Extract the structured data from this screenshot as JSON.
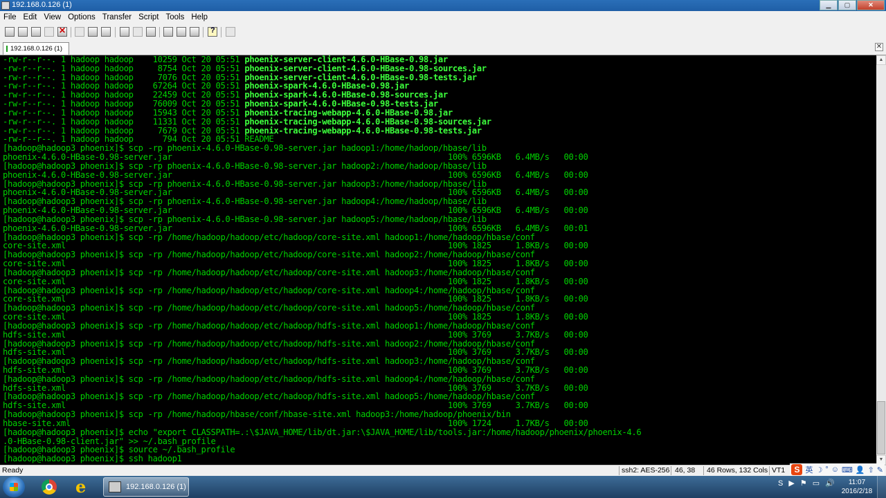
{
  "window": {
    "title": "192.168.0.126 (1)",
    "buttons": {
      "minimize": "▁",
      "maximize": "▢",
      "close": "✕"
    }
  },
  "menu": [
    "File",
    "Edit",
    "View",
    "Options",
    "Transfer",
    "Script",
    "Tools",
    "Help"
  ],
  "toolbar_icons": [
    "connect-icon",
    "quick-connect-icon",
    "connect-in-tab-icon",
    "reconnect-icon",
    "disconnect-icon",
    "copy-icon",
    "paste-icon",
    "find-icon",
    "print-icon",
    "print-setup-icon",
    "print-selection-icon",
    "session-options-icon",
    "global-options-icon",
    "keymap-icon",
    "help-icon",
    "sftp-icon"
  ],
  "tab": {
    "label": "192.168.0.126 (1)",
    "close_glyph": "✕"
  },
  "terminal": {
    "colors": {
      "background": "#000000",
      "text": "#00d000",
      "highlight": "#3cff3c"
    },
    "lines": [
      {
        "text": "-rw-r--r--. 1 hadoop hadoop    10259 Oct 20 05:51 ",
        "hl": "phoenix-server-client-4.6.0-HBase-0.98.jar"
      },
      {
        "text": "-rw-r--r--. 1 hadoop hadoop     8754 Oct 20 05:51 ",
        "hl": "phoenix-server-client-4.6.0-HBase-0.98-sources.jar"
      },
      {
        "text": "-rw-r--r--. 1 hadoop hadoop     7076 Oct 20 05:51 ",
        "hl": "phoenix-server-client-4.6.0-HBase-0.98-tests.jar"
      },
      {
        "text": "-rw-r--r--. 1 hadoop hadoop    67264 Oct 20 05:51 ",
        "hl": "phoenix-spark-4.6.0-HBase-0.98.jar"
      },
      {
        "text": "-rw-r--r--. 1 hadoop hadoop    22459 Oct 20 05:51 ",
        "hl": "phoenix-spark-4.6.0-HBase-0.98-sources.jar"
      },
      {
        "text": "-rw-r--r--. 1 hadoop hadoop    76009 Oct 20 05:51 ",
        "hl": "phoenix-spark-4.6.0-HBase-0.98-tests.jar"
      },
      {
        "text": "-rw-r--r--. 1 hadoop hadoop    15943 Oct 20 05:51 ",
        "hl": "phoenix-tracing-webapp-4.6.0-HBase-0.98.jar"
      },
      {
        "text": "-rw-r--r--. 1 hadoop hadoop    11331 Oct 20 05:51 ",
        "hl": "phoenix-tracing-webapp-4.6.0-HBase-0.98-sources.jar"
      },
      {
        "text": "-rw-r--r--. 1 hadoop hadoop     7679 Oct 20 05:51 ",
        "hl": "phoenix-tracing-webapp-4.6.0-HBase-0.98-tests.jar"
      },
      {
        "text": "-rw-r--r--. 1 hadoop hadoop      794 Oct 20 05:51 README",
        "hl": ""
      },
      {
        "text": "[hadoop@hadoop3 phoenix]$ scp -rp phoenix-4.6.0-HBase-0.98-server.jar hadoop1:/home/hadoop/hbase/lib",
        "hl": ""
      },
      {
        "text": "phoenix-4.6.0-HBase-0.98-server.jar                                                         100% 6596KB   6.4MB/s   00:00",
        "hl": ""
      },
      {
        "text": "[hadoop@hadoop3 phoenix]$ scp -rp phoenix-4.6.0-HBase-0.98-server.jar hadoop2:/home/hadoop/hbase/lib",
        "hl": ""
      },
      {
        "text": "phoenix-4.6.0-HBase-0.98-server.jar                                                         100% 6596KB   6.4MB/s   00:00",
        "hl": ""
      },
      {
        "text": "[hadoop@hadoop3 phoenix]$ scp -rp phoenix-4.6.0-HBase-0.98-server.jar hadoop3:/home/hadoop/hbase/lib",
        "hl": ""
      },
      {
        "text": "phoenix-4.6.0-HBase-0.98-server.jar                                                         100% 6596KB   6.4MB/s   00:00",
        "hl": ""
      },
      {
        "text": "[hadoop@hadoop3 phoenix]$ scp -rp phoenix-4.6.0-HBase-0.98-server.jar hadoop4:/home/hadoop/hbase/lib",
        "hl": ""
      },
      {
        "text": "phoenix-4.6.0-HBase-0.98-server.jar                                                         100% 6596KB   6.4MB/s   00:00",
        "hl": ""
      },
      {
        "text": "[hadoop@hadoop3 phoenix]$ scp -rp phoenix-4.6.0-HBase-0.98-server.jar hadoop5:/home/hadoop/hbase/lib",
        "hl": ""
      },
      {
        "text": "phoenix-4.6.0-HBase-0.98-server.jar                                                         100% 6596KB   6.4MB/s   00:01",
        "hl": ""
      },
      {
        "text": "[hadoop@hadoop3 phoenix]$ scp -rp /home/hadoop/hadoop/etc/hadoop/core-site.xml hadoop1:/home/hadoop/hbase/conf",
        "hl": ""
      },
      {
        "text": "core-site.xml                                                                               100% 1825     1.8KB/s   00:00",
        "hl": ""
      },
      {
        "text": "[hadoop@hadoop3 phoenix]$ scp -rp /home/hadoop/hadoop/etc/hadoop/core-site.xml hadoop2:/home/hadoop/hbase/conf",
        "hl": ""
      },
      {
        "text": "core-site.xml                                                                               100% 1825     1.8KB/s   00:00",
        "hl": ""
      },
      {
        "text": "[hadoop@hadoop3 phoenix]$ scp -rp /home/hadoop/hadoop/etc/hadoop/core-site.xml hadoop3:/home/hadoop/hbase/conf",
        "hl": ""
      },
      {
        "text": "core-site.xml                                                                               100% 1825     1.8KB/s   00:00",
        "hl": ""
      },
      {
        "text": "[hadoop@hadoop3 phoenix]$ scp -rp /home/hadoop/hadoop/etc/hadoop/core-site.xml hadoop4:/home/hadoop/hbase/conf",
        "hl": ""
      },
      {
        "text": "core-site.xml                                                                               100% 1825     1.8KB/s   00:00",
        "hl": ""
      },
      {
        "text": "[hadoop@hadoop3 phoenix]$ scp -rp /home/hadoop/hadoop/etc/hadoop/core-site.xml hadoop5:/home/hadoop/hbase/conf",
        "hl": ""
      },
      {
        "text": "core-site.xml                                                                               100% 1825     1.8KB/s   00:00",
        "hl": ""
      },
      {
        "text": "[hadoop@hadoop3 phoenix]$ scp -rp /home/hadoop/hadoop/etc/hadoop/hdfs-site.xml hadoop1:/home/hadoop/hbase/conf",
        "hl": ""
      },
      {
        "text": "hdfs-site.xml                                                                               100% 3769     3.7KB/s   00:00",
        "hl": ""
      },
      {
        "text": "[hadoop@hadoop3 phoenix]$ scp -rp /home/hadoop/hadoop/etc/hadoop/hdfs-site.xml hadoop2:/home/hadoop/hbase/conf",
        "hl": ""
      },
      {
        "text": "hdfs-site.xml                                                                               100% 3769     3.7KB/s   00:00",
        "hl": ""
      },
      {
        "text": "[hadoop@hadoop3 phoenix]$ scp -rp /home/hadoop/hadoop/etc/hadoop/hdfs-site.xml hadoop3:/home/hadoop/hbase/conf",
        "hl": ""
      },
      {
        "text": "hdfs-site.xml                                                                               100% 3769     3.7KB/s   00:00",
        "hl": ""
      },
      {
        "text": "[hadoop@hadoop3 phoenix]$ scp -rp /home/hadoop/hadoop/etc/hadoop/hdfs-site.xml hadoop4:/home/hadoop/hbase/conf",
        "hl": ""
      },
      {
        "text": "hdfs-site.xml                                                                               100% 3769     3.7KB/s   00:00",
        "hl": ""
      },
      {
        "text": "[hadoop@hadoop3 phoenix]$ scp -rp /home/hadoop/hadoop/etc/hadoop/hdfs-site.xml hadoop5:/home/hadoop/hbase/conf",
        "hl": ""
      },
      {
        "text": "hdfs-site.xml                                                                               100% 3769     3.7KB/s   00:00",
        "hl": ""
      },
      {
        "text": "[hadoop@hadoop3 phoenix]$ scp -rp /home/hadoop/hbase/conf/hbase-site.xml hadoop3:/home/hadoop/phoenix/bin",
        "hl": ""
      },
      {
        "text": "hbase-site.xml                                                                              100% 1724     1.7KB/s   00:00",
        "hl": ""
      },
      {
        "text": "[hadoop@hadoop3 phoenix]$ echo \"export CLASSPATH=.:\\$JAVA_HOME/lib/dt.jar:\\$JAVA_HOME/lib/tools.jar:/home/hadoop/phoenix/phoenix-4.6",
        "hl": ""
      },
      {
        "text": ".0-HBase-0.98-client.jar\" >> ~/.bash_profile",
        "hl": ""
      },
      {
        "text": "[hadoop@hadoop3 phoenix]$ source ~/.bash_profile",
        "hl": ""
      },
      {
        "text": "[hadoop@hadoop3 phoenix]$ ssh hadoop1",
        "hl": ""
      }
    ]
  },
  "scrollbar": {
    "up": "▲",
    "down": "▼"
  },
  "status": {
    "ready": "Ready",
    "cipher": "ssh2: AES-256",
    "cursor": "46,  38",
    "size": "46 Rows, 132 Cols",
    "term": "VT1"
  },
  "ime_tray": {
    "logo": "S",
    "lang": "英",
    "items": [
      "☽",
      "°",
      "☺",
      "⌨",
      "👤",
      "⇧",
      "✎"
    ]
  },
  "taskbar": {
    "task_label": "192.168.0.126 (1)",
    "tray_icons": [
      "S",
      "▶",
      "⚑",
      "▭",
      "🔊"
    ],
    "time": "11:07",
    "date": "2016/2/18"
  }
}
